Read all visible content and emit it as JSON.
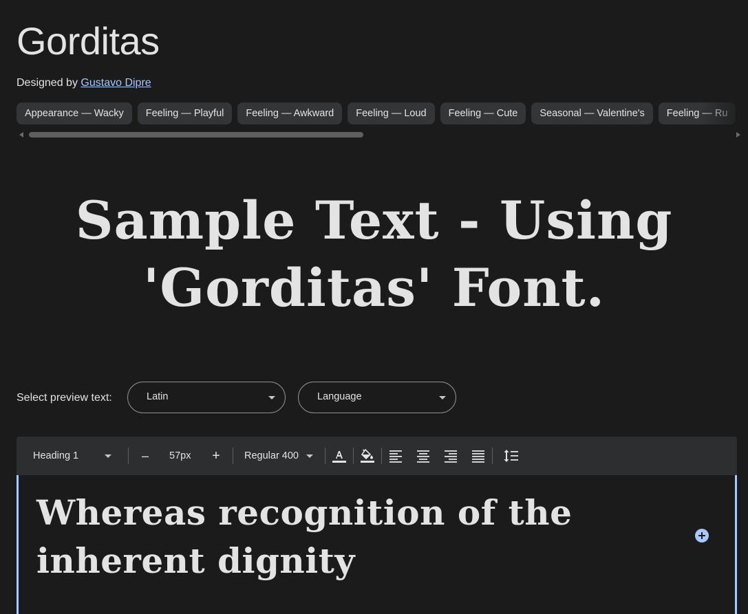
{
  "font": {
    "name": "Gorditas",
    "designed_by_prefix": "Designed by",
    "designer": "Gustavo Dipre"
  },
  "tags": [
    "Appearance — Wacky",
    "Feeling — Playful",
    "Feeling — Awkward",
    "Feeling — Loud",
    "Feeling — Cute",
    "Seasonal — Valentine's",
    "Feeling — Ru"
  ],
  "sample_text": "Sample Text - Using 'Gorditas' Font.",
  "preview": {
    "label": "Select preview text:",
    "script_select": "Latin",
    "language_select": "Language"
  },
  "toolbar": {
    "style": "Heading 1",
    "decrease": "–",
    "size": "57px",
    "increase": "+",
    "weight": "Regular 400",
    "icons": [
      "text-color-icon",
      "highlight-color-icon",
      "align-left-icon",
      "align-center-icon",
      "align-right-icon",
      "align-justify-icon",
      "line-height-icon"
    ]
  },
  "editor": {
    "text": "Whereas recognition of the inherent dignity"
  },
  "colors": {
    "background": "#1b1b1b",
    "chip": "#333537",
    "toolbar": "#2d2e30",
    "accent": "#a8c7fa",
    "text": "#e3e3e3"
  }
}
